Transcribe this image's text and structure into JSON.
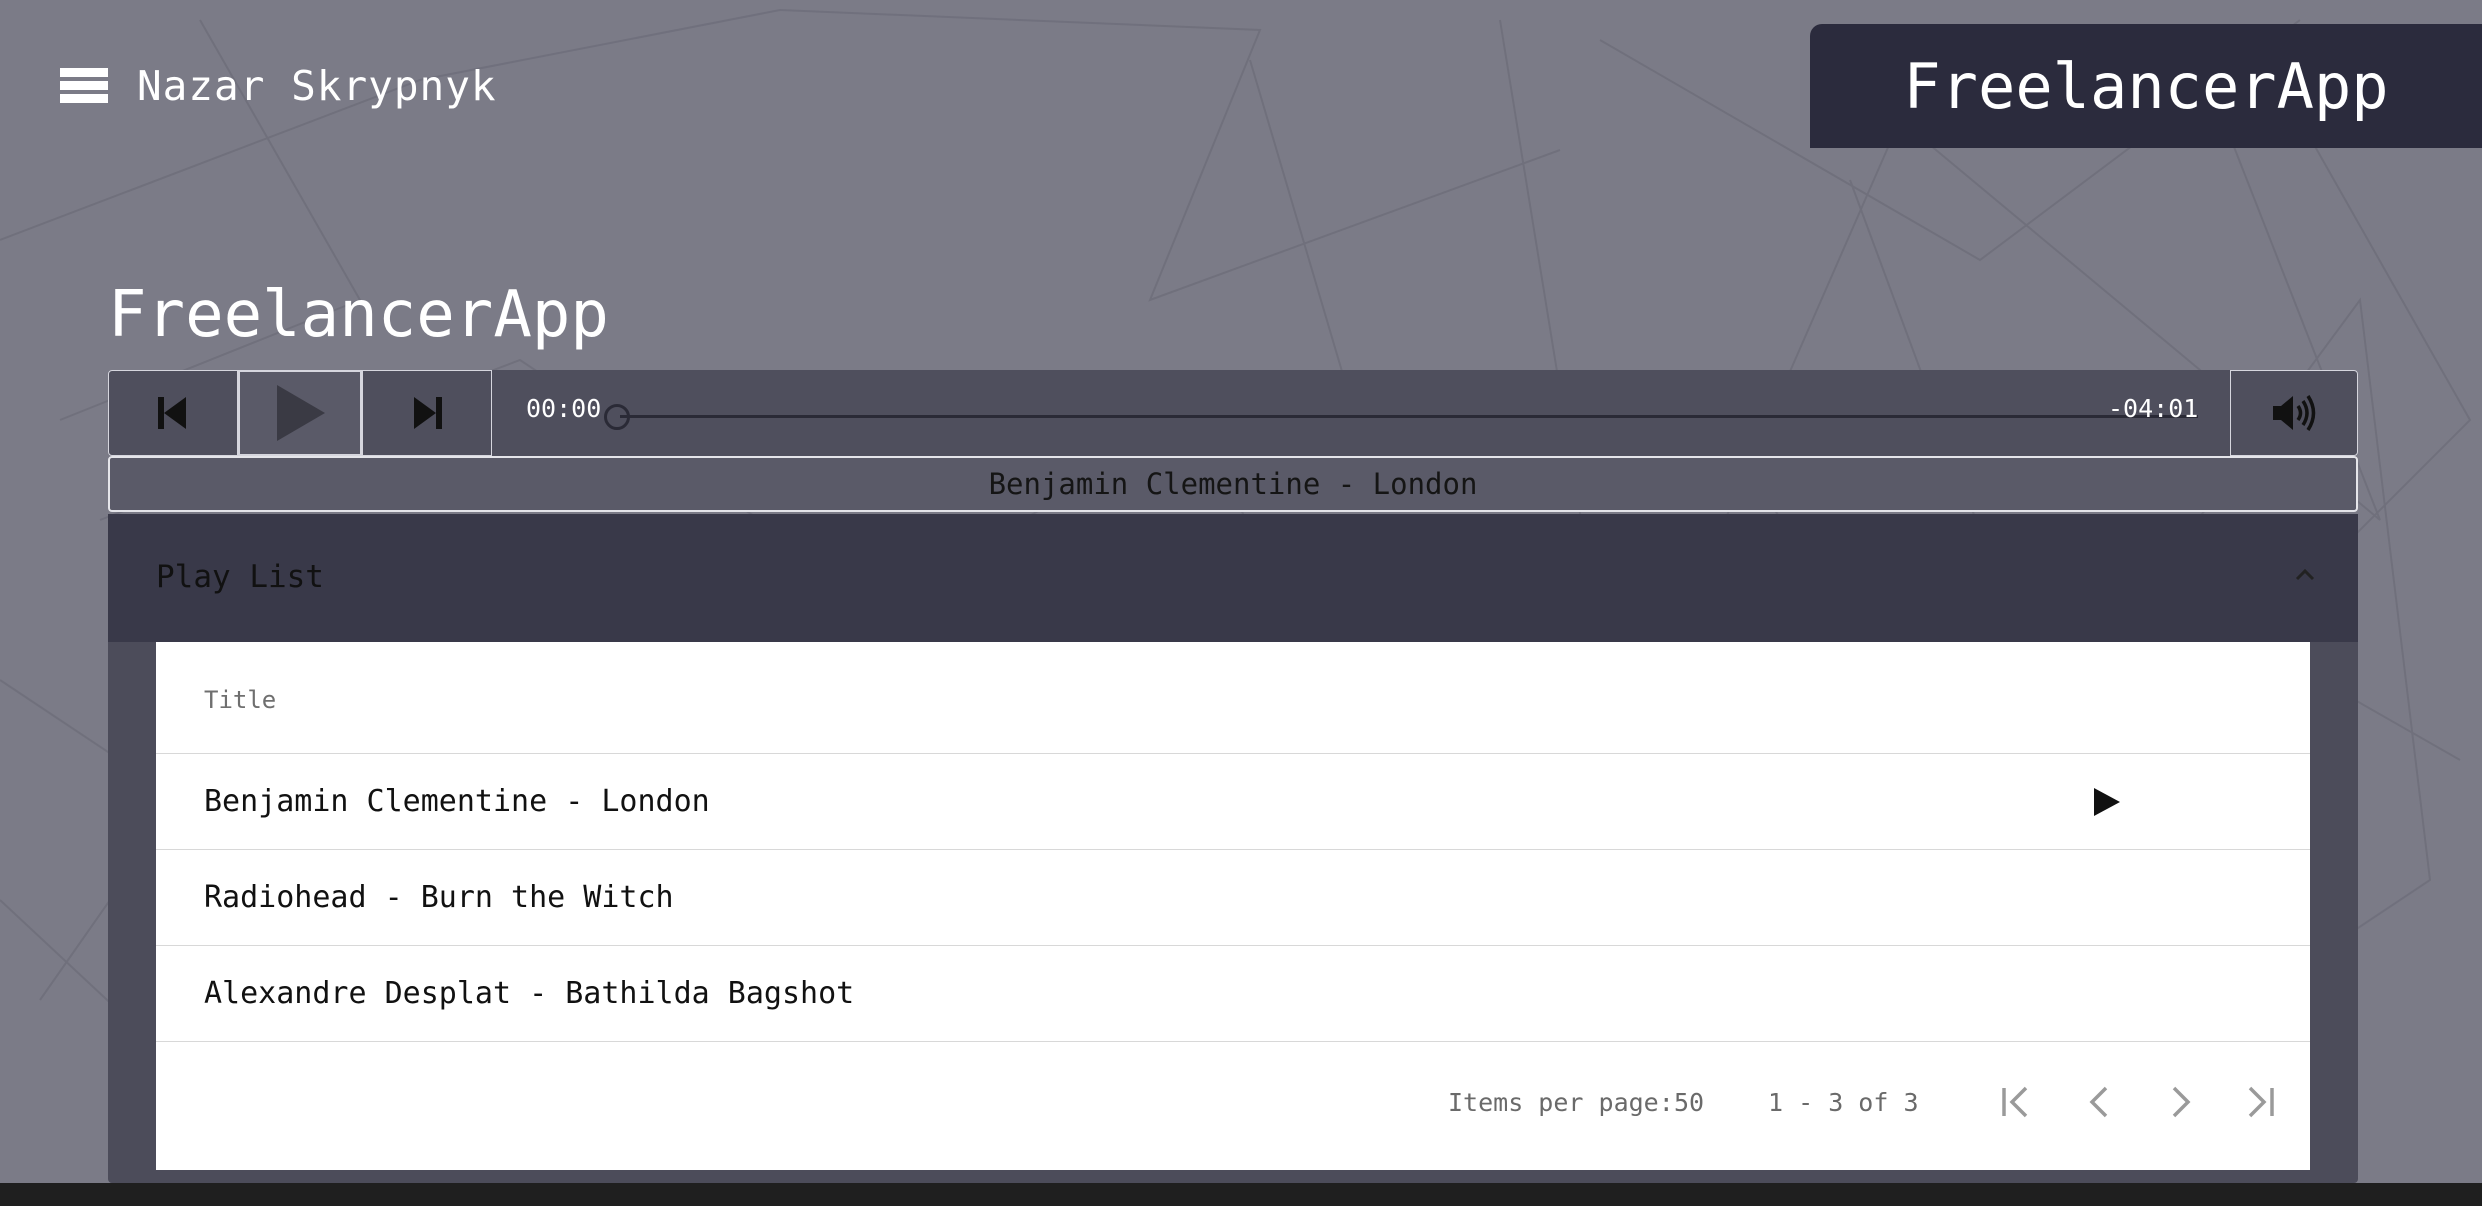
{
  "header": {
    "user_name": "Nazar Skrypnyk",
    "brand": "FreelancerApp",
    "menu_icon": "hamburger-menu-icon"
  },
  "page": {
    "title": "FreelancerApp"
  },
  "player": {
    "current_time": "00:00",
    "remaining_time": "-04:01",
    "progress": 0,
    "now_playing": "Benjamin Clementine - London",
    "icons": {
      "prev": "skip-previous-icon",
      "play": "play-icon",
      "next": "skip-next-icon",
      "volume": "volume-up-icon"
    }
  },
  "playlist": {
    "label": "Play List",
    "expanded": true,
    "column_header": "Title",
    "rows": [
      {
        "title": "Benjamin Clementine - London",
        "playing_indicator": true
      },
      {
        "title": "Radiohead - Burn the Witch",
        "playing_indicator": false
      },
      {
        "title": "Alexandre Desplat - Bathilda Bagshot",
        "playing_indicator": false
      }
    ]
  },
  "paginator": {
    "items_per_page_label": "Items per page:",
    "page_size": "50",
    "range_label": "1 - 3 of 3"
  },
  "colors": {
    "background": "#7b7b87",
    "brand_box": "#2b2b3d",
    "player_bg": "#4f4f5d",
    "playlist_header": "#393949"
  }
}
